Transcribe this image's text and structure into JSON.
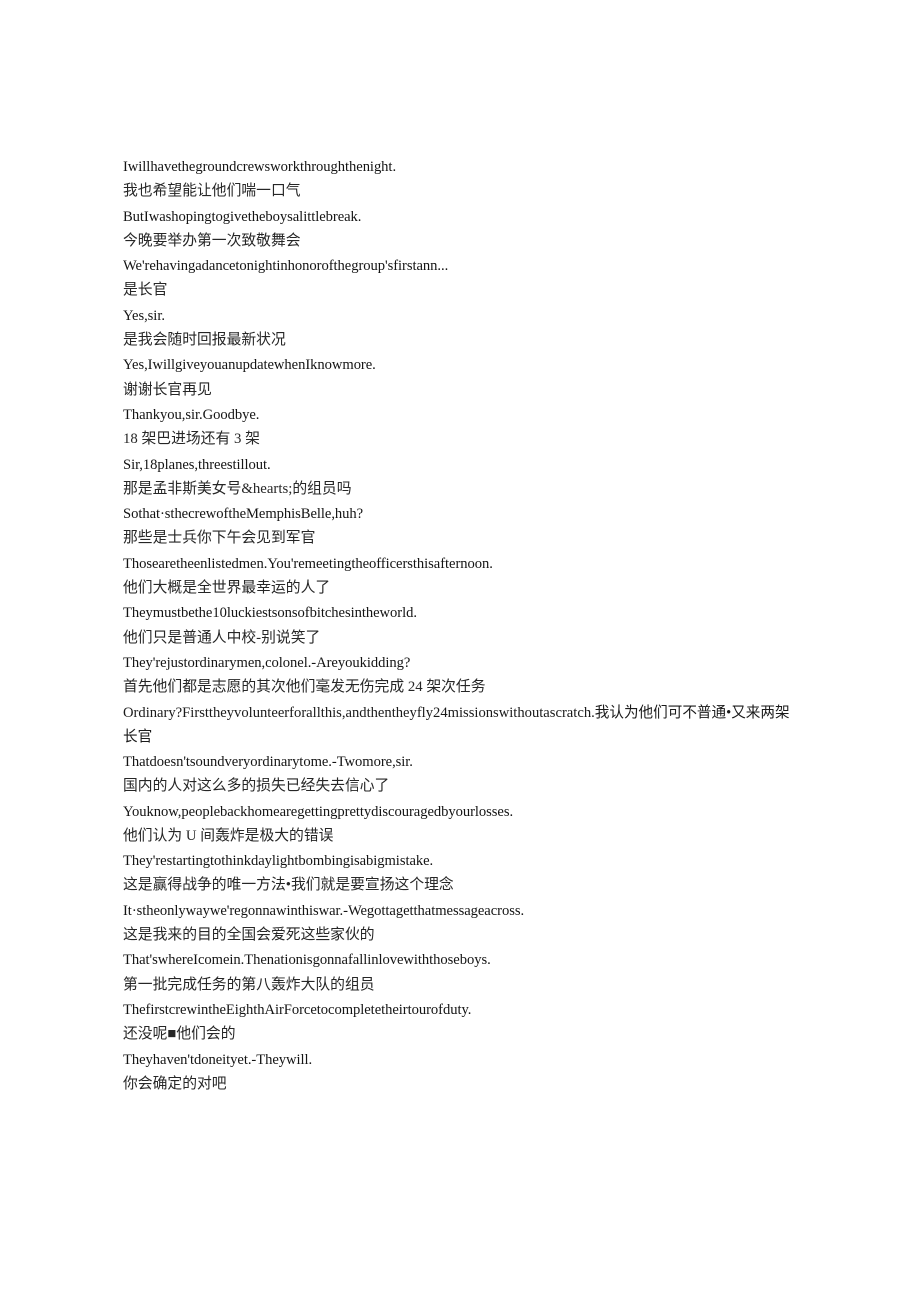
{
  "document": {
    "background_color": "#ffffff",
    "text_color": "#1a1a1a",
    "lines": [
      {
        "lang": "en",
        "text": "Iwillhavethegroundcrewsworkthroughthenight."
      },
      {
        "lang": "zh",
        "text": "我也希望能让他们喘一口气"
      },
      {
        "lang": "en",
        "text": "ButIwashopingtogivetheboysalittlebreak."
      },
      {
        "lang": "zh",
        "text": "今晚要举办第一次致敬舞会"
      },
      {
        "lang": "en",
        "text": "We'rehavingadancetonightinhonorofthegroup'sfirstann..."
      },
      {
        "lang": "zh",
        "text": "是长官"
      },
      {
        "lang": "en",
        "text": "Yes,sir."
      },
      {
        "lang": "zh",
        "text": "是我会随时回报最新状况"
      },
      {
        "lang": "en",
        "text": "Yes,IwillgiveyouanupdatewhenIknowmore."
      },
      {
        "lang": "zh",
        "text": "谢谢长官再见"
      },
      {
        "lang": "en",
        "text": "Thankyou,sir.Goodbye."
      },
      {
        "lang": "zh",
        "text": "18 架巴进场还有 3 架"
      },
      {
        "lang": "en",
        "text": "Sir,18planes,threestillout."
      },
      {
        "lang": "zh",
        "text": "那是孟非斯美女号&hearts;的组员吗"
      },
      {
        "lang": "en",
        "text": "Sothat·sthecrewoftheMemphisBelle,huh?"
      },
      {
        "lang": "zh",
        "text": "那些是士兵你下午会见到军官"
      },
      {
        "lang": "en",
        "text": "Thosearetheenlistedmen.You'remeetingtheofficersthisafternoon."
      },
      {
        "lang": "zh",
        "text": "他们大概是全世界最幸运的人了"
      },
      {
        "lang": "en",
        "text": "Theymustbethe10luckiestsonsofbitchesintheworld."
      },
      {
        "lang": "zh",
        "text": "他们只是普通人中校-别说笑了"
      },
      {
        "lang": "en",
        "text": "They'rejustordinarymen,colonel.-Areyoukidding?"
      },
      {
        "lang": "zh",
        "text": "首先他们都是志愿的其次他们毫发无伤完成 24 架次任务"
      },
      {
        "lang": "mixed",
        "text": "Ordinary?Firsttheyvolunteerforallthis,andthentheyfly24missionswithoutascratch.我认为他们可不普通•又来两架长官"
      },
      {
        "lang": "en",
        "text": "Thatdoesn'tsoundveryordinarytome.-Twomore,sir."
      },
      {
        "lang": "zh",
        "text": "国内的人对这么多的损失已经失去信心了"
      },
      {
        "lang": "en",
        "text": "Youknow,peoplebackhomearegettingprettydiscouragedbyourlosses."
      },
      {
        "lang": "zh",
        "text": "他们认为 U 间轰炸是极大的错误"
      },
      {
        "lang": "en",
        "text": "They'restartingtothinkdaylightbombingisabigmistake."
      },
      {
        "lang": "zh",
        "text": "这是赢得战争的唯一方法•我们就是要宣扬这个理念"
      },
      {
        "lang": "en",
        "text": "It·stheonlywaywe'regonnawinthiswar.-Wegottagetthatmessageacross."
      },
      {
        "lang": "zh",
        "text": "这是我来的目的全国会爱死这些家伙的"
      },
      {
        "lang": "en",
        "text": "That'swhereIcomein.Thenationisgonnafallinlovewiththoseboys."
      },
      {
        "lang": "zh",
        "text": "第一批完成任务的第八轰炸大队的组员"
      },
      {
        "lang": "en",
        "text": "ThefirstcrewintheEighthAirForcetocompletetheirtourofduty."
      },
      {
        "lang": "zh",
        "text": "还没呢■他们会的"
      },
      {
        "lang": "en",
        "text": "Theyhaven'tdoneityet.-Theywill."
      },
      {
        "lang": "zh",
        "text": "你会确定的对吧"
      }
    ]
  }
}
